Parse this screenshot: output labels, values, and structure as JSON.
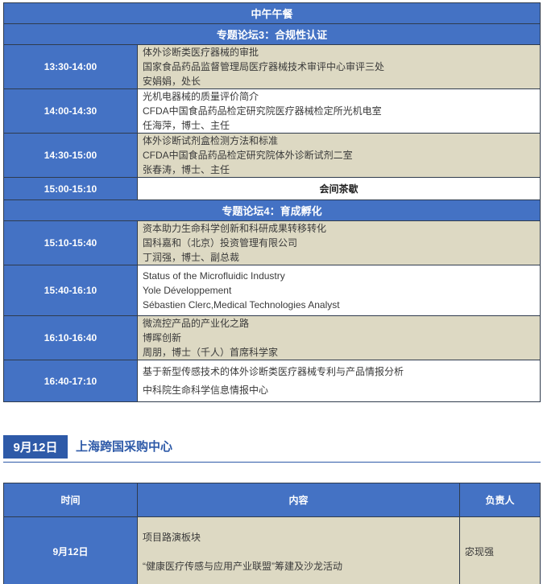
{
  "schedule": {
    "lunch": "中午午餐",
    "forum3_title": "专题论坛3：合规性认证",
    "forum4_title": "专题论坛4：育成孵化",
    "rows_a": [
      {
        "time": "13:30-14:00",
        "lines": [
          "体外诊断类医疗器械的审批",
          "国家食品药品监督管理局医疗器械技术审评中心审评三处",
          "安娟娟，处长"
        ]
      },
      {
        "time": "14:00-14:30",
        "lines": [
          "光机电器械的质量评价简介",
          "CFDA中国食品药品检定研究院医疗器械检定所光机电室",
          "任海萍，博士、主任"
        ]
      },
      {
        "time": "14:30-15:00",
        "lines": [
          "体外诊断试剂盒检测方法和标准",
          "CFDA中国食品药品检定研究院体外诊断试剂二室",
          "张春涛，博士、主任"
        ]
      }
    ],
    "break": {
      "time": "15:00-15:10",
      "label": "会间茶歇"
    },
    "rows_b": [
      {
        "time": "15:10-15:40",
        "lines": [
          "资本助力生命科学创新和科研成果转移转化",
          "国科嘉和（北京）投资管理有限公司",
          "丁润强，博士、副总裁"
        ]
      },
      {
        "time": "15:40-16:10",
        "lines": [
          "Status of the   Microfluidic Industry",
          "Yole Développement",
          "Sébastien Clerc,Medical  Technologies Analyst"
        ]
      },
      {
        "time": "16:10-16:40",
        "lines": [
          "微流控产品的产业化之路",
          "博晖创新",
          "周朋，博士（千人）首席科学家"
        ]
      },
      {
        "time": "16:40-17:10",
        "lines": [
          "基于新型传感技术的体外诊断类医疗器械专利与产品情报分析",
          "中科院生命科学信息情报中心"
        ]
      }
    ]
  },
  "day": {
    "badge": "9月12日",
    "title": "上海跨国采购中心"
  },
  "table2": {
    "headers": [
      "时间",
      "内容",
      "负责人"
    ],
    "row": {
      "date": "9月12日",
      "lines": [
        "项目路演板块",
        "“健康医疗传感与应用产业联盟”筹建及沙龙活动"
      ],
      "owner": "宓现强"
    }
  }
}
